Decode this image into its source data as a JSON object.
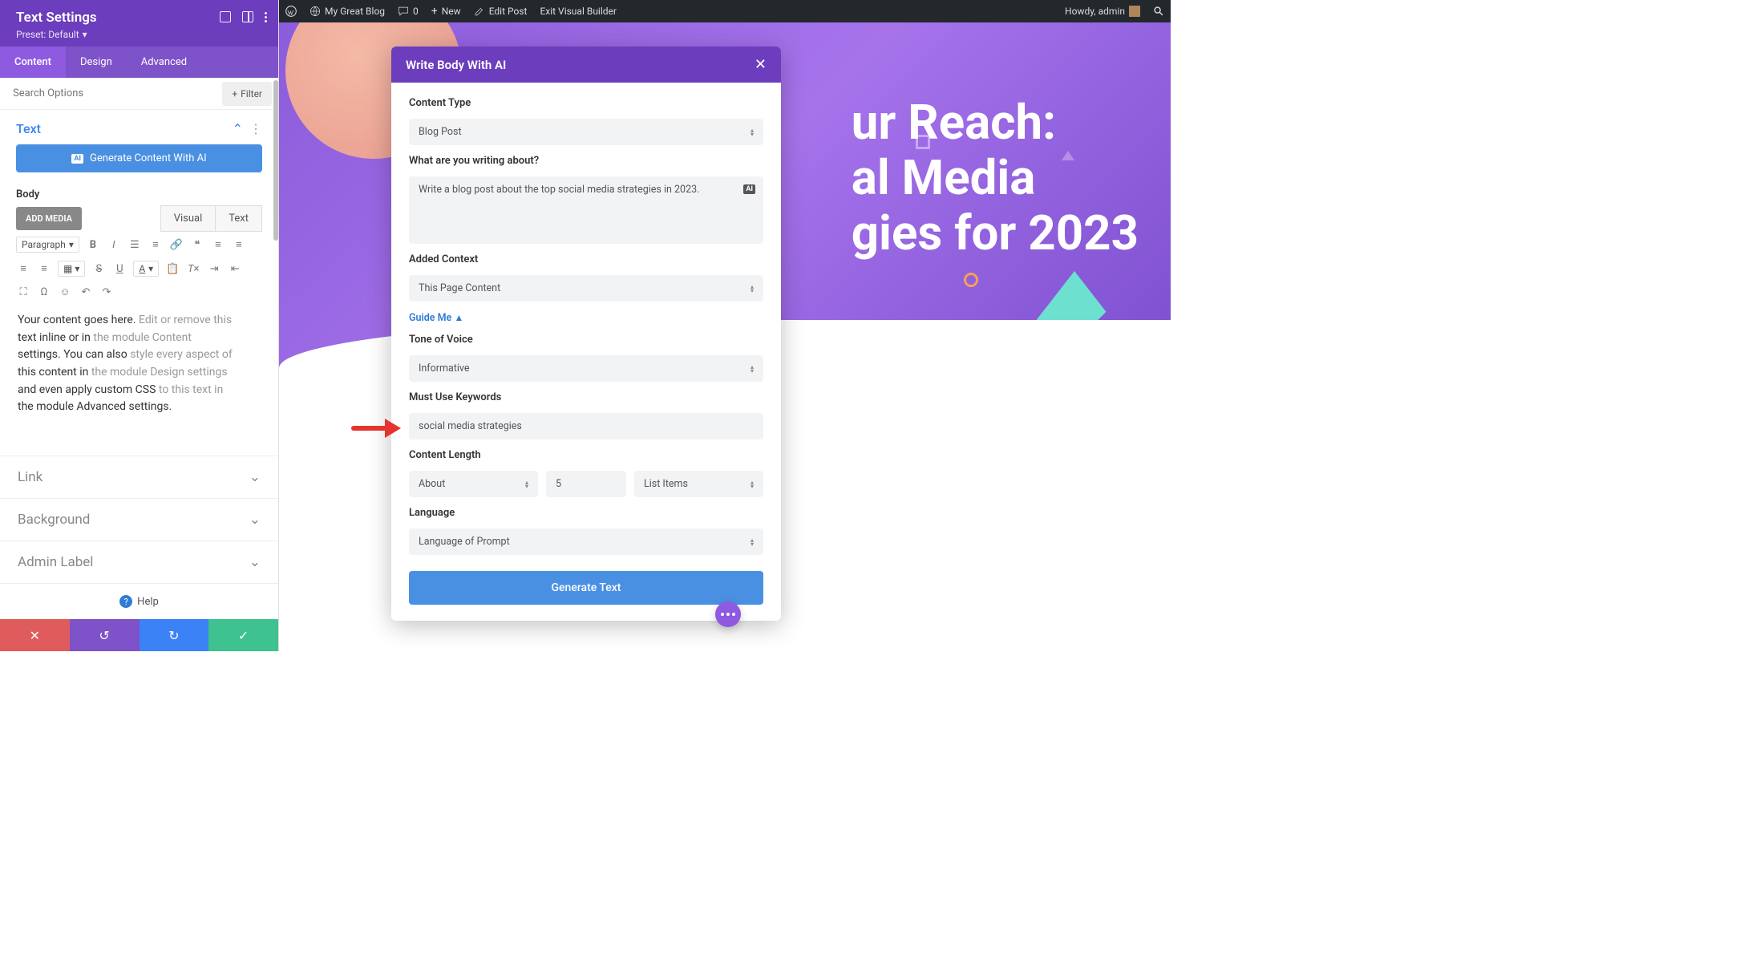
{
  "wpbar": {
    "site": "My Great Blog",
    "comments": "0",
    "new": "New",
    "edit": "Edit Post",
    "exit": "Exit Visual Builder",
    "howdy": "Howdy, admin"
  },
  "sidebar": {
    "title": "Text Settings",
    "preset": "Preset: Default",
    "tabs": [
      "Content",
      "Design",
      "Advanced"
    ],
    "search_placeholder": "Search Options",
    "filter_label": "Filter",
    "text_label": "Text",
    "generate_btn": "Generate Content With AI",
    "body_label": "Body",
    "add_media": "ADD MEDIA",
    "visual": "Visual",
    "text_tab": "Text",
    "paragraph": "Paragraph",
    "content_p1a": "Your content goes here. ",
    "content_p1b": "Edit or remove this",
    "content_p2a": "text inline or in ",
    "content_p2b": "the module Content",
    "content_p3a": "settings. You can also ",
    "content_p3b": "style every aspect of",
    "content_p4a": "this content in ",
    "content_p4b": "the module Design settings",
    "content_p5a": "and even apply custom CSS ",
    "content_p5b": "to this text in",
    "content_p6a": "the module ",
    "content_p6b": "Advanced settings.",
    "acc": [
      "Link",
      "Background",
      "Admin Label"
    ],
    "help": "Help"
  },
  "hero": {
    "line1": "ur Reach:",
    "line2": "al Media",
    "line3": "gies for 2023"
  },
  "modal": {
    "title": "Write Body With AI",
    "labels": {
      "content_type": "Content Type",
      "writing_about": "What are you writing about?",
      "added_context": "Added Context",
      "guide": "Guide Me",
      "tone": "Tone of Voice",
      "keywords": "Must Use Keywords",
      "length": "Content Length",
      "language": "Language"
    },
    "values": {
      "content_type": "Blog Post",
      "writing_about": "Write a blog post about the top social media strategies in 2023.",
      "added_context": "This Page Content",
      "tone": "Informative",
      "keywords": "social media strategies",
      "length_mode": "About",
      "length_num": "5",
      "length_unit": "List Items",
      "language": "Language of Prompt"
    },
    "generate": "Generate Text"
  }
}
